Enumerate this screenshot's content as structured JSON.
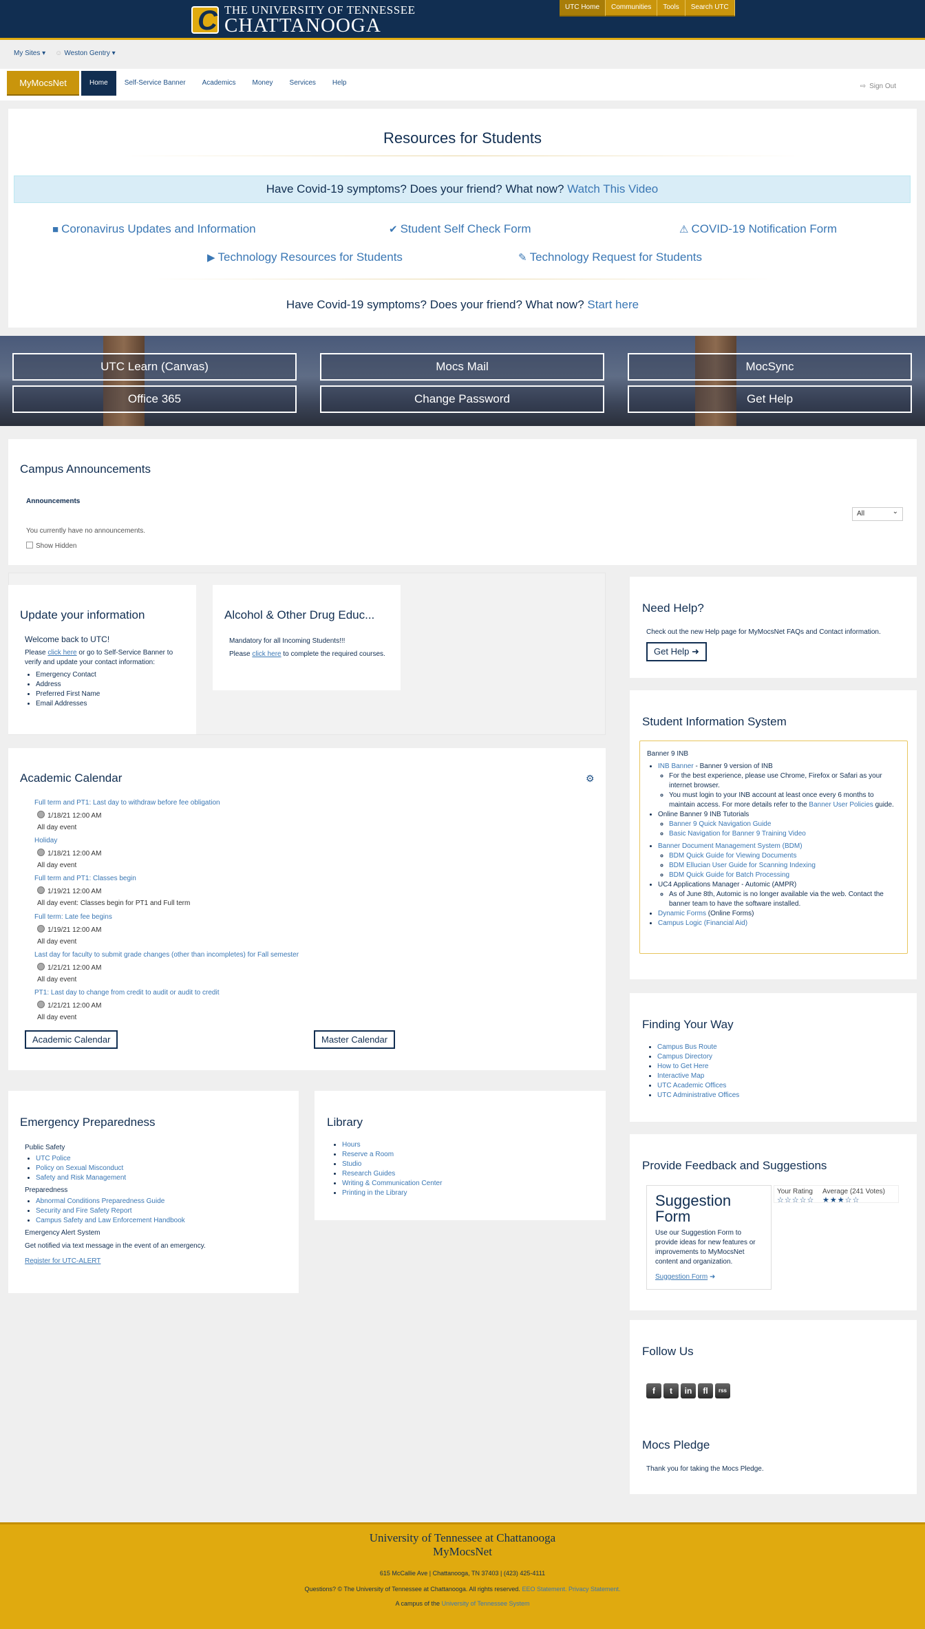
{
  "header": {
    "logo_line1": "THE UNIVERSITY OF TENNESSEE",
    "logo_line2": "CHATTANOOGA",
    "utc_nav": [
      "UTC Home",
      "Communities",
      "Tools",
      "Search UTC"
    ]
  },
  "user_bar": {
    "my_sites": "My Sites",
    "user": "Weston Gentry"
  },
  "nav": {
    "brand": "MyMocsNet",
    "tabs": [
      "Home",
      "Self-Service Banner",
      "Academics",
      "Money",
      "Services",
      "Help"
    ],
    "sign_out": "Sign Out"
  },
  "resources": {
    "title": "Resources for Students",
    "covid_bar_text": "Have Covid-19 symptoms? Does your friend? What now?",
    "covid_bar_link": "Watch This Video",
    "links": [
      {
        "label": "Coronavirus Updates and Information",
        "icon": "comment-icon"
      },
      {
        "label": "Student Self Check Form",
        "icon": "check-icon"
      },
      {
        "label": "COVID-19 Notification Form",
        "icon": "warning-icon"
      },
      {
        "label": "Technology Resources for Students",
        "icon": "video-camera-icon"
      },
      {
        "label": "Technology Request for Students",
        "icon": "pencil-icon"
      }
    ],
    "start_text": "Have Covid-19 symptoms? Does your friend? What now?",
    "start_link": "Start here"
  },
  "quick_links": [
    "UTC Learn (Canvas)",
    "Mocs Mail",
    "MocSync",
    "Office 365",
    "Change Password",
    "Get Help"
  ],
  "announcements": {
    "title": "Campus Announcements",
    "tab": "Announcements",
    "filter": "All",
    "empty": "You currently have no announcements.",
    "show_hidden": "Show Hidden"
  },
  "update_info": {
    "title": "Update your information",
    "welcome": "Welcome back to UTC!",
    "p1": "Please",
    "p_link": "click here",
    "p2": "or go to Self-Service Banner to verify and update your contact information:",
    "items": [
      "Emergency Contact",
      "Address",
      "Preferred First Name",
      "Email Addresses"
    ]
  },
  "alcohol": {
    "title": "Alcohol & Other Drug Educ...",
    "mandatory": "Mandatory for all Incoming Students!!!",
    "p1": "Please",
    "p_link": "click here",
    "p2": "to complete the required courses."
  },
  "help": {
    "title": "Need Help?",
    "text": "Check out the new Help page for MyMocsNet FAQs and Contact information.",
    "button": "Get Help"
  },
  "sis": {
    "title": "Student Information System",
    "heading": "Banner 9 INB",
    "inb_link": "INB Banner",
    "inb_text": " - Banner 9 version of INB",
    "inb_sub1": "For the best experience, please use Chrome, Firefox or Safari as your internet browser.",
    "inb_sub2a": "You must login to your INB account at least once every 6 months to maintain access. For more details refer to the",
    "inb_sub2_link": "Banner User Policies",
    "inb_sub2b": "guide.",
    "tutorials": "Online Banner 9 INB Tutorials",
    "tutorial_links": [
      "Banner 9 Quick Navigation Guide",
      "Basic Navigation for Banner 9 Training Video"
    ],
    "bdm": "Banner Document Management System (BDM)",
    "bdm_links": [
      "BDM Quick Guide for Viewing Documents",
      "BDM Ellucian User Guide for Scanning Indexing",
      "BDM Quick Guide for Batch Processing"
    ],
    "uc4": "UC4 Applications Manager - Automic (AMPR)",
    "uc4_sub": "As of June 8th, Automic is no longer available via the web. Contact the banner team to have the software installed.",
    "dyn_link": "Dynamic Forms",
    "dyn_text": " (Online Forms)",
    "logic": "Campus Logic (Financial Aid)"
  },
  "calendar": {
    "title": "Academic Calendar",
    "events": [
      {
        "title": "Full term and PT1: Last day to withdraw before fee obligation",
        "date": "1/18/21 12:00 AM",
        "desc": "All day event"
      },
      {
        "title": "Holiday",
        "date": "1/18/21 12:00 AM",
        "desc": "All day event"
      },
      {
        "title": "Full term and PT1: Classes begin",
        "date": "1/19/21 12:00 AM",
        "desc": "All day event: Classes begin for PT1 and Full term"
      },
      {
        "title": "Full term: Late fee begins",
        "date": "1/19/21 12:00 AM",
        "desc": "All day event"
      },
      {
        "title": "Last day for faculty to submit grade changes (other than incompletes) for Fall semester",
        "date": "1/21/21 12:00 AM",
        "desc": "All day event"
      },
      {
        "title": "PT1: Last day to change from credit to audit or audit to credit",
        "date": "1/21/21 12:00 AM",
        "desc": "All day event"
      }
    ],
    "btn_academic": "Academic Calendar",
    "btn_master": "Master Calendar"
  },
  "finding": {
    "title": "Finding Your Way",
    "links": [
      "Campus Bus Route",
      "Campus Directory",
      "How to Get Here",
      "Interactive Map",
      "UTC Academic Offices",
      "UTC Administrative Offices"
    ]
  },
  "emergency": {
    "title": "Emergency Preparedness",
    "public_safety": "Public Safety",
    "ps_links": [
      "UTC Police",
      "Policy on Sexual Misconduct",
      "Safety and Risk Management"
    ],
    "preparedness": "Preparedness",
    "prep_links": [
      "Abnormal Conditions Preparedness Guide",
      "Security and Fire Safety Report",
      "Campus Safety and Law Enforcement Handbook"
    ],
    "alert_heading": "Emergency Alert System",
    "alert_text": "Get notified via text message in the event of an emergency.",
    "alert_link": "Register for UTC-ALERT"
  },
  "library": {
    "title": "Library",
    "links": [
      "Hours",
      "Reserve a Room",
      "Studio",
      "Research Guides",
      "Writing & Communication Center",
      "Printing in the Library"
    ]
  },
  "feedback": {
    "title": "Provide Feedback and Suggestions",
    "card_title": "Suggestion Form",
    "card_text": "Use our Suggestion Form to provide ideas for new features or improvements to MyMocsNet content and organization.",
    "card_link": "Suggestion Form",
    "your_rating": "Your Rating",
    "average": "Average (241 Votes)",
    "your_rating_value": 0,
    "average_value": 3
  },
  "follow": {
    "title": "Follow Us",
    "icons": [
      "facebook-icon",
      "twitter-icon",
      "linkedin-icon",
      "flickr-icon",
      "rss-icon"
    ],
    "glyphs": [
      "f",
      "t",
      "in",
      "fl",
      "rss"
    ]
  },
  "pledge": {
    "title": "Mocs Pledge",
    "text": "Thank you for taking the Mocs Pledge."
  },
  "footer": {
    "line1": "University of Tennessee at Chattanooga",
    "line2": "MyMocsNet",
    "address": "615 McCallie Ave | Chattanooga, TN 37403 | (423) 425-4111",
    "questions": "Questions? © The University of Tennessee at Chattanooga. All rights reserved.",
    "eeo": "EEO Statement.",
    "privacy": "Privacy Statement.",
    "campus_of": "A campus of the",
    "system": "University of Tennessee System"
  }
}
